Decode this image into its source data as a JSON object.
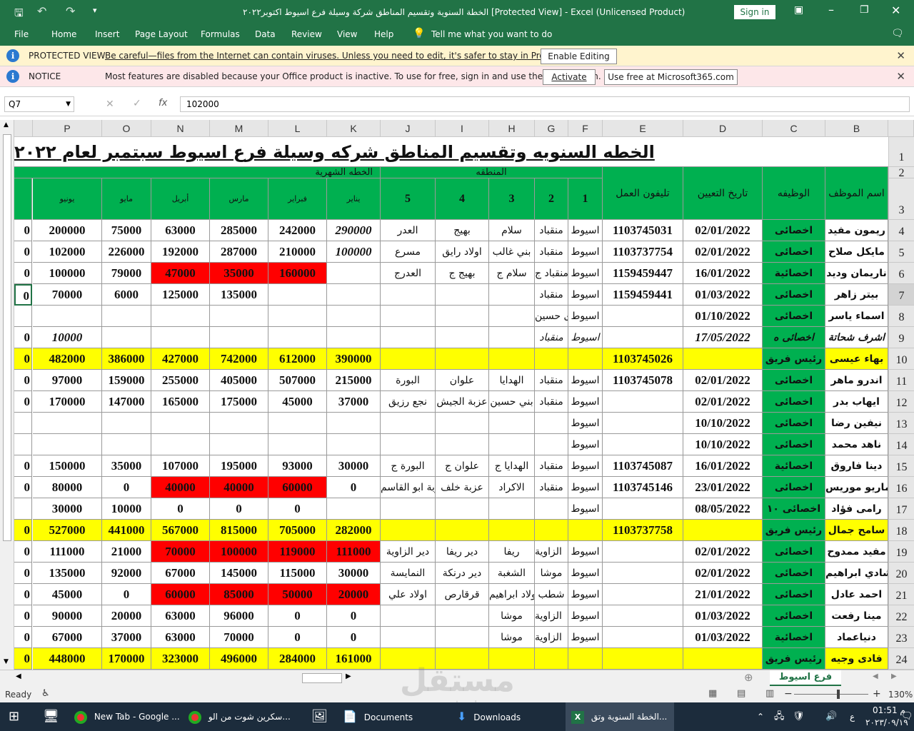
{
  "window": {
    "title": "الخطة السنوية وتقسيم المناطق  شركة وسيلة فرع اسيوط اكتوبر٢٠٢٢  [Protected View]  -  Excel (Unlicensed Product)",
    "sign_in": "Sign in"
  },
  "ribbon": {
    "tabs": [
      "File",
      "Home",
      "Insert",
      "Page Layout",
      "Formulas",
      "Data",
      "Review",
      "View",
      "Help"
    ],
    "tell_me": "Tell me what you want to do"
  },
  "protected_bar": {
    "label": "PROTECTED VIEW",
    "message": "Be careful—files from the Internet can contain viruses. Unless you need to edit, it's safer to stay in Protected View.",
    "button": "Enable Editing"
  },
  "notice_bar": {
    "label": "NOTICE",
    "message": "Most features are disabled because your Office product is inactive. To use for free, sign in and use the Web version.",
    "activate": "Activate",
    "use_free": "Use free at Microsoft365.com"
  },
  "formula_bar": {
    "name_box": "Q7",
    "fx": "fx",
    "value": "102000"
  },
  "sheet": {
    "columns": [
      "P",
      "O",
      "N",
      "M",
      "L",
      "K",
      "J",
      "I",
      "H",
      "G",
      "F",
      "E",
      "D",
      "C",
      "B"
    ],
    "row_numbers": [
      "1",
      "2",
      "3",
      "4",
      "5",
      "6",
      "7",
      "8",
      "9",
      "10",
      "11",
      "12",
      "13",
      "14",
      "15",
      "16",
      "17",
      "18",
      "19",
      "20",
      "21",
      "22",
      "23",
      "24"
    ],
    "title": "الخطه السنويه وتقسيم المناطق شركه وسيلة فرع اسيوط سبتمبر لعام ٢٠٢٢",
    "headers": {
      "monthly_plan": "الخطه الشهرية",
      "region": "المنطقه",
      "phone": "تليفون العمل",
      "hire_date": "تاريخ التعيين",
      "job": "الوظيفه",
      "name": "اسم الموظف",
      "months": [
        "يونيو",
        "مايو",
        "أبريل",
        "مارس",
        "فبراير",
        "يناير"
      ],
      "zones": [
        "5",
        "4",
        "3",
        "2",
        "1"
      ]
    },
    "rows": [
      {
        "r": "4",
        "name": "ريمون مفيد",
        "job": "اخصائى",
        "date": "02/01/2022",
        "phone": "1103745031",
        "z1": "اسيوط",
        "z2": "منقباد",
        "z3": "سلام",
        "z4": "بهيج",
        "z5": "العدر",
        "jan": "290000",
        "feb": "242000",
        "mar": "285000",
        "apr": "63000",
        "may": "75000",
        "jun": "200000",
        "q": "0",
        "fill": "",
        "jan_it": true
      },
      {
        "r": "5",
        "name": "مايكل صلاح",
        "job": "اخصائى",
        "date": "02/01/2022",
        "phone": "1103737754",
        "z1": "اسيوط",
        "z2": "منقباد",
        "z3": "بني غالب",
        "z4": "اولاد رايق",
        "z5": "مسرع",
        "jan": "100000",
        "feb": "210000",
        "mar": "287000",
        "apr": "192000",
        "may": "226000",
        "jun": "102000",
        "q": "0",
        "fill": "",
        "jan_it": true
      },
      {
        "r": "6",
        "name": "ناريمان وديد",
        "job": "اخصائية",
        "date": "16/01/2022",
        "phone": "1159459447",
        "z1": "اسيوط",
        "z2": "منقباد ج",
        "z3": "سلام ج",
        "z4": "بهيج ج",
        "z5": "العدرج",
        "jan": "",
        "feb": "160000",
        "mar": "35000",
        "apr": "47000",
        "may": "79000",
        "jun": "100000",
        "q": "0",
        "fill": "",
        "red": [
          "feb",
          "mar",
          "apr"
        ]
      },
      {
        "r": "7",
        "name": "بيتر زاهر",
        "job": "اخصائى",
        "date": "01/03/2022",
        "phone": "1159459441",
        "z1": "اسيوط",
        "z2": "منقباد",
        "z3": "",
        "z4": "",
        "z5": "",
        "jan": "",
        "feb": "",
        "mar": "135000",
        "apr": "125000",
        "may": "6000",
        "jun": "70000",
        "q": "0",
        "fill": ""
      },
      {
        "r": "8",
        "name": "اسماء ياسر",
        "job": "اخصائى",
        "date": "01/10/2022",
        "phone": "",
        "z1": "اسيوط",
        "z2": "ى حسين",
        "z3": "",
        "z4": "",
        "z5": "",
        "jan": "",
        "feb": "",
        "mar": "",
        "apr": "",
        "may": "",
        "jun": "",
        "q": "",
        "fill": ""
      },
      {
        "r": "9",
        "name": "اشرف شحاتة",
        "job": "اخصائى ه",
        "date": "17/05/2022",
        "phone": "",
        "z1": "اسيوط",
        "z2": "منقباد",
        "z3": "",
        "z4": "",
        "z5": "",
        "jan": "",
        "feb": "",
        "mar": "",
        "apr": "",
        "may": "",
        "jun": "10000",
        "q": "0",
        "fill": "",
        "italic": true
      },
      {
        "r": "10",
        "name": "بهاء عيسى",
        "job": "رئيس فريق",
        "date": "",
        "phone": "1103745026",
        "z1": "",
        "z2": "",
        "z3": "",
        "z4": "",
        "z5": "",
        "jan": "390000",
        "feb": "612000",
        "mar": "742000",
        "apr": "427000",
        "may": "386000",
        "jun": "482000",
        "q": "0",
        "fill": "yellow"
      },
      {
        "r": "11",
        "name": "اندرو ماهر",
        "job": "اخصائى",
        "date": "02/01/2022",
        "phone": "1103745078",
        "z1": "اسيوط",
        "z2": "منقباد",
        "z3": "الهدايا",
        "z4": "علوان",
        "z5": "البورة",
        "jan": "215000",
        "feb": "507000",
        "mar": "405000",
        "apr": "255000",
        "may": "159000",
        "jun": "97000",
        "q": "0",
        "fill": ""
      },
      {
        "r": "12",
        "name": "ايهاب بدر",
        "job": "اخصائى",
        "date": "02/01/2022",
        "phone": "",
        "z1": "اسيوط",
        "z2": "منقباد",
        "z3": "بني حسين",
        "z4": "عزبة الجيش",
        "z5": "نجع رزيق",
        "jan": "37000",
        "feb": "45000",
        "mar": "175000",
        "apr": "165000",
        "may": "147000",
        "jun": "170000",
        "q": "0",
        "fill": ""
      },
      {
        "r": "13",
        "name": "نيفين رضا",
        "job": "اخصائى",
        "date": "10/10/2022",
        "phone": "",
        "z1": "اسيوط",
        "z2": "",
        "z3": "",
        "z4": "",
        "z5": "",
        "jan": "",
        "feb": "",
        "mar": "",
        "apr": "",
        "may": "",
        "jun": "",
        "q": "",
        "fill": ""
      },
      {
        "r": "14",
        "name": "ناهد محمد",
        "job": "اخصائى",
        "date": "10/10/2022",
        "phone": "",
        "z1": "اسيوط",
        "z2": "",
        "z3": "",
        "z4": "",
        "z5": "",
        "jan": "",
        "feb": "",
        "mar": "",
        "apr": "",
        "may": "",
        "jun": "",
        "q": "",
        "fill": ""
      },
      {
        "r": "15",
        "name": "دينا فاروق",
        "job": "اخصائية",
        "date": "16/01/2022",
        "phone": "1103745087",
        "z1": "اسيوط",
        "z2": "منقباد",
        "z3": "الهدايا ج",
        "z4": "علوان ج",
        "z5": "البورة ج",
        "jan": "30000",
        "feb": "93000",
        "mar": "195000",
        "apr": "107000",
        "may": "35000",
        "jun": "150000",
        "q": "0",
        "fill": ""
      },
      {
        "r": "16",
        "name": "ماريو موريس",
        "job": "اخصائى",
        "date": "23/01/2022",
        "phone": "1103745146",
        "z1": "اسيوط",
        "z2": "منقباد",
        "z3": "الاكراد",
        "z4": "عزبة خلف",
        "z5": "عزبة ابو القاسم",
        "jan": "0",
        "feb": "60000",
        "mar": "40000",
        "apr": "40000",
        "may": "0",
        "jun": "80000",
        "q": "0",
        "fill": "",
        "red": [
          "feb",
          "mar",
          "apr"
        ]
      },
      {
        "r": "17",
        "name": "رامى فؤاد",
        "job": "اخصائى ١٠",
        "date": "08/05/2022",
        "phone": "",
        "z1": "اسيوط",
        "z2": "",
        "z3": "",
        "z4": "",
        "z5": "",
        "jan": "",
        "feb": "0",
        "mar": "0",
        "apr": "0",
        "may": "10000",
        "jun": "30000",
        "q": "",
        "fill": ""
      },
      {
        "r": "18",
        "name": "سامح جمال",
        "job": "رئيس فريق",
        "date": "",
        "phone": "1103737758",
        "z1": "",
        "z2": "",
        "z3": "",
        "z4": "",
        "z5": "",
        "jan": "282000",
        "feb": "705000",
        "mar": "815000",
        "apr": "567000",
        "may": "441000",
        "jun": "527000",
        "q": "0",
        "fill": "yellow"
      },
      {
        "r": "19",
        "name": "مفيد ممدوح",
        "job": "اخصائى",
        "date": "02/01/2022",
        "phone": "",
        "z1": "اسيوط",
        "z2": "الزاوية",
        "z3": "ريفا",
        "z4": "دير ريفا",
        "z5": "دير الزاوية",
        "jan": "111000",
        "feb": "119000",
        "mar": "100000",
        "apr": "70000",
        "may": "21000",
        "jun": "111000",
        "q": "0",
        "fill": "",
        "red": [
          "jan",
          "feb",
          "mar",
          "apr"
        ]
      },
      {
        "r": "20",
        "name": "شادي ابراهيم",
        "job": "اخصائى",
        "date": "02/01/2022",
        "phone": "",
        "z1": "اسيوط",
        "z2": "موشا",
        "z3": "الشغبة",
        "z4": "دير درنكة",
        "z5": "النمايسة",
        "jan": "30000",
        "feb": "115000",
        "mar": "145000",
        "apr": "67000",
        "may": "92000",
        "jun": "135000",
        "q": "0",
        "fill": ""
      },
      {
        "r": "21",
        "name": "احمد عادل",
        "job": "اخصائى",
        "date": "21/01/2022",
        "phone": "",
        "z1": "اسيوط",
        "z2": "شطب",
        "z3": "ولاد ابراهيم",
        "z4": "قرقارص",
        "z5": "اولاد علي",
        "jan": "20000",
        "feb": "50000",
        "mar": "85000",
        "apr": "60000",
        "may": "0",
        "jun": "45000",
        "q": "0",
        "fill": "",
        "red": [
          "jan",
          "feb",
          "mar",
          "apr"
        ]
      },
      {
        "r": "22",
        "name": "مينا رفعت",
        "job": "اخصائى",
        "date": "01/03/2022",
        "phone": "",
        "z1": "اسيوط",
        "z2": "الزاوية",
        "z3": "موشا",
        "z4": "",
        "z5": "",
        "jan": "0",
        "feb": "0",
        "mar": "96000",
        "apr": "63000",
        "may": "20000",
        "jun": "90000",
        "q": "0",
        "fill": ""
      },
      {
        "r": "23",
        "name": "دنياعماد",
        "job": "اخصائية",
        "date": "01/03/2022",
        "phone": "",
        "z1": "اسيوط",
        "z2": "الزاوية",
        "z3": "موشا",
        "z4": "",
        "z5": "",
        "jan": "0",
        "feb": "0",
        "mar": "70000",
        "apr": "63000",
        "may": "37000",
        "jun": "67000",
        "q": "0",
        "fill": ""
      },
      {
        "r": "24",
        "name": "فادى وجيه",
        "job": "رئيس فريق",
        "date": "",
        "phone": "",
        "z1": "",
        "z2": "",
        "z3": "",
        "z4": "",
        "z5": "",
        "jan": "161000",
        "feb": "284000",
        "mar": "496000",
        "apr": "323000",
        "may": "170000",
        "jun": "448000",
        "q": "0",
        "fill": "yellow"
      }
    ]
  },
  "sheet_tabs": {
    "active": "فرع اسيوط"
  },
  "status": {
    "ready": "Ready",
    "zoom": "130%"
  },
  "taskbar": {
    "items": [
      "New Tab - Google ...",
      "سكرين شوت من الو...",
      "Documents",
      "Downloads",
      "الخطة السنوية وتق..."
    ],
    "time": "01:51 م",
    "date": "٢٠٢٣/٠٩/١٩",
    "lang": "ع"
  },
  "watermark": {
    "text": "مستقل",
    "sub": "mostaql.com"
  },
  "colors": {
    "excel_green": "#217346",
    "header_green": "#00b050",
    "highlight_yellow": "#ffff00",
    "alert_red": "#ff0000"
  }
}
